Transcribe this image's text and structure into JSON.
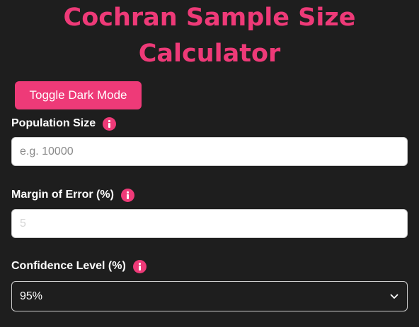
{
  "header": {
    "title_line1": "Cochran Sample Size",
    "title_line2": "Calculator"
  },
  "toolbar": {
    "toggle_label": "Toggle Dark Mode"
  },
  "fields": {
    "population": {
      "label": "Population Size",
      "value": "",
      "placeholder": "e.g. 10000"
    },
    "margin": {
      "label": "Margin of Error (%)",
      "value": "",
      "placeholder": "5"
    },
    "confidence": {
      "label": "Confidence Level (%)",
      "selected": "95%"
    }
  },
  "colors": {
    "accent": "#ee3a78",
    "background": "#1e1e1e"
  },
  "icons": {
    "info": "info-icon",
    "dropdown": "chevron-down-icon"
  }
}
